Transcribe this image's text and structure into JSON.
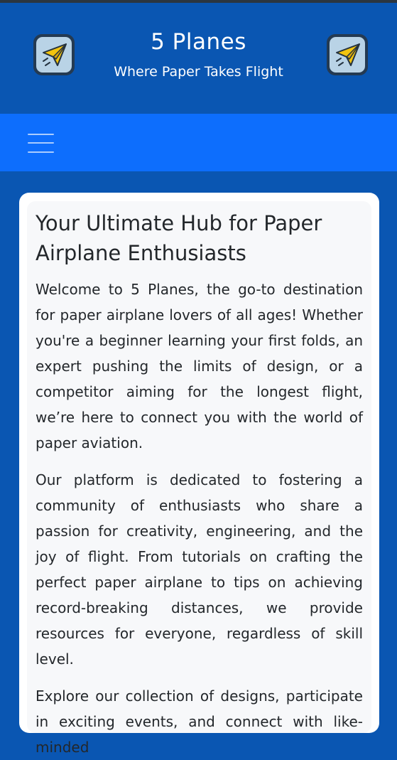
{
  "header": {
    "title": "5 Planes",
    "subtitle": "Where Paper Takes Flight",
    "logo_icon": "paper-plane-icon"
  },
  "nav": {
    "menu_icon": "hamburger-menu-icon"
  },
  "main": {
    "heading": "Your Ultimate Hub for Paper Airplane Enthusiasts",
    "paragraphs": [
      "Welcome to 5 Planes, the go-to destination for paper airplane lovers of all ages! Whether you're a beginner learning your first folds, an expert pushing the limits of design, or a competitor aiming for the longest flight, we’re here to connect you with the world of paper aviation.",
      "Our platform is dedicated to fostering a community of enthusiasts who share a passion for creativity, engineering, and the joy of flight. From tutorials on crafting the perfect paper airplane to tips on achieving record-breaking distances, we provide resources for everyone, regardless of skill level.",
      "Explore our collection of designs, participate in exciting events, and connect with like-minded"
    ]
  },
  "colors": {
    "header_bg": "#0a56b2",
    "nav_bg": "#0d6efd",
    "card_bg": "#f7f8fa"
  }
}
